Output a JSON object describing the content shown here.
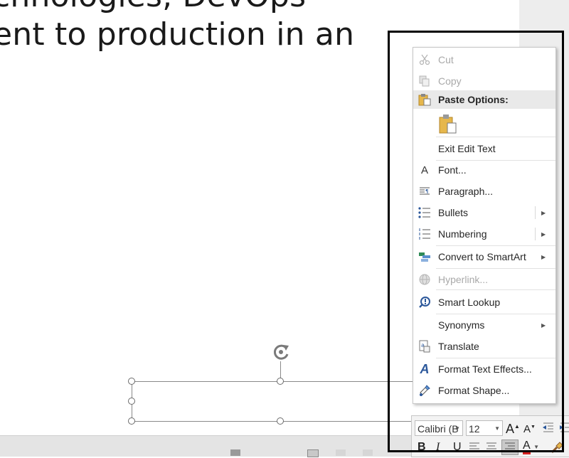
{
  "slide": {
    "line1": "chnologies, DevOps",
    "line2": "ent to production in an"
  },
  "context_menu": {
    "items": [
      {
        "label": "Cut",
        "icon": "scissors-icon",
        "disabled": true
      },
      {
        "label": "Copy",
        "icon": "copy-icon",
        "disabled": true
      },
      {
        "label": "Paste Options:",
        "icon": "paste-icon",
        "header": true
      },
      {
        "label": "Exit Edit Text"
      },
      {
        "label": "Font...",
        "icon": "font-icon"
      },
      {
        "label": "Paragraph...",
        "icon": "paragraph-icon"
      },
      {
        "label": "Bullets",
        "icon": "bullets-icon",
        "submenu": true
      },
      {
        "label": "Numbering",
        "icon": "numbering-icon",
        "submenu": true
      },
      {
        "label": "Convert to SmartArt",
        "icon": "smartart-icon",
        "submenu": true
      },
      {
        "label": "Hyperlink...",
        "icon": "hyperlink-icon",
        "disabled": true
      },
      {
        "label": "Smart Lookup",
        "icon": "smart-lookup-icon"
      },
      {
        "label": "Synonyms",
        "submenu": true
      },
      {
        "label": "Translate",
        "icon": "translate-icon"
      },
      {
        "label": "Format Text Effects...",
        "icon": "text-effects-icon"
      },
      {
        "label": "Format Shape...",
        "icon": "format-shape-icon"
      }
    ]
  },
  "mini_toolbar": {
    "font_name": "Calibri (B",
    "font_size": "12",
    "grow_font": "A",
    "shrink_font": "A",
    "bold": "B",
    "italic": "I",
    "underline": "U",
    "font_color_letter": "A"
  },
  "colors": {
    "accent_blue": "#2b579a",
    "font_color_bar": "#d42020",
    "paste_gold": "#e6b74c"
  }
}
